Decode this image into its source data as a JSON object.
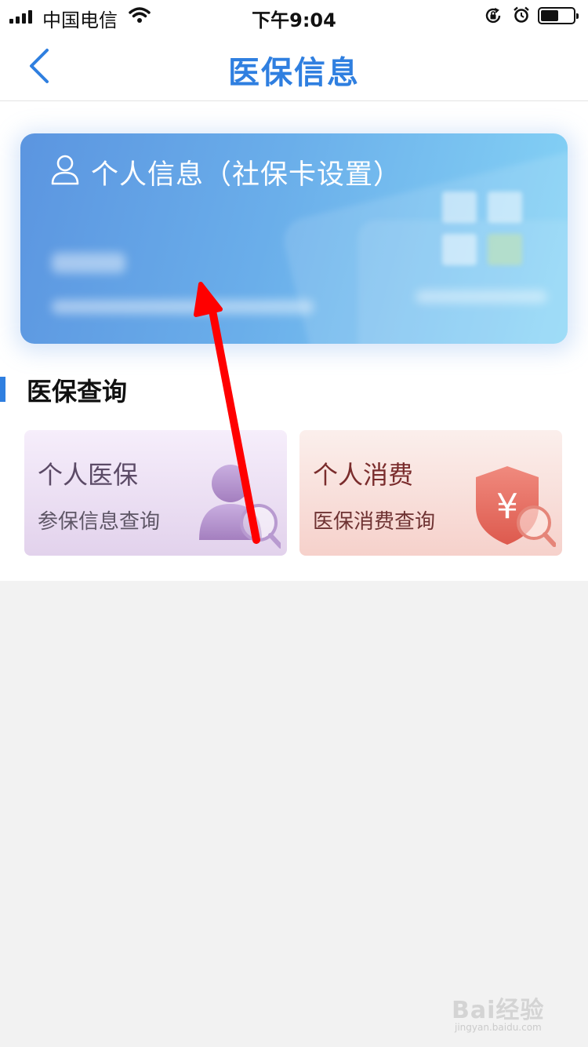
{
  "status_bar": {
    "carrier": "中国电信",
    "time": "下午9:04"
  },
  "nav": {
    "title": "医保信息",
    "back_icon": "chevron-left-icon"
  },
  "card": {
    "title": "个人信息（社保卡设置）",
    "icon": "user-icon"
  },
  "section": {
    "title": "医保查询"
  },
  "tiles": [
    {
      "title": "个人医保",
      "subtitle": "参保信息查询",
      "icon": "person-search-icon",
      "color": "#e2d2ec"
    },
    {
      "title": "个人消费",
      "subtitle": "医保消费查询",
      "icon": "yuan-shield-search-icon",
      "color": "#f6d1cb"
    }
  ],
  "annotation": {
    "arrow_color": "#ff0000"
  },
  "watermark": {
    "logo_text": "Bai经验",
    "url": "jingyan.baidu.com"
  },
  "colors": {
    "accent": "#2f7fe0",
    "background": "#f2f2f2"
  }
}
